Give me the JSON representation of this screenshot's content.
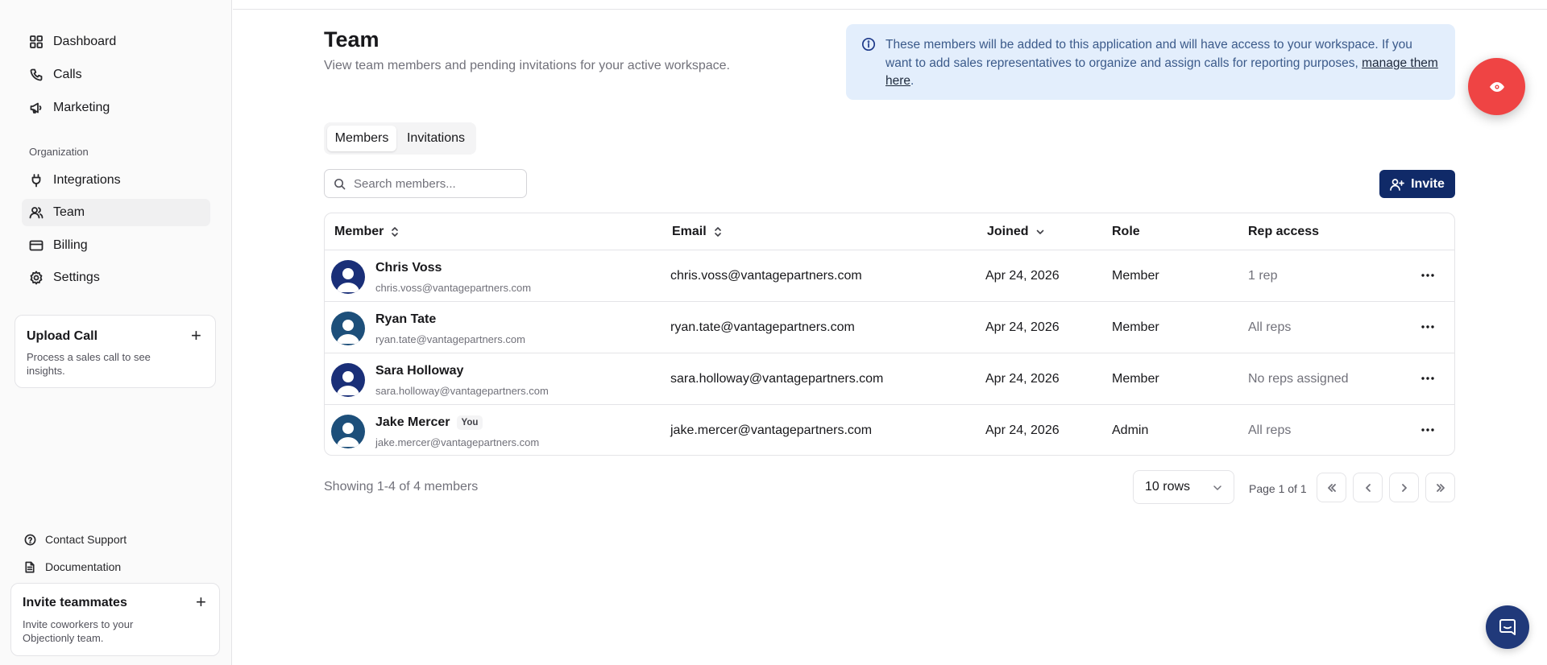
{
  "sidebar": {
    "nav": [
      {
        "label": "Dashboard",
        "icon": "dashboard-grid-icon"
      },
      {
        "label": "Calls",
        "icon": "phone-icon"
      },
      {
        "label": "Marketing",
        "icon": "megaphone-icon"
      }
    ],
    "section_label": "Organization",
    "org_nav": [
      {
        "label": "Integrations",
        "icon": "plug-icon"
      },
      {
        "label": "Team",
        "icon": "users-icon",
        "active": true
      },
      {
        "label": "Billing",
        "icon": "credit-card-icon"
      },
      {
        "label": "Settings",
        "icon": "gear-icon"
      }
    ],
    "upload_card": {
      "title": "Upload Call",
      "description": "Process a sales call to see insights.",
      "plus": "+"
    },
    "footer_links": [
      {
        "label": "Contact Support",
        "icon": "help-circle-icon"
      },
      {
        "label": "Documentation",
        "icon": "document-icon"
      }
    ],
    "invite_card": {
      "title": "Invite teammates",
      "description": "Invite coworkers to your Objectionly team.",
      "plus": "+"
    }
  },
  "header": {
    "title": "Team",
    "subtitle": "View team members and pending invitations for your active workspace."
  },
  "info_box": {
    "text": "These members will be added to this application and will have access to your workspace. If you want to add sales representatives to organize and assign calls for reporting purposes, ",
    "link": "manage them here",
    "end": "."
  },
  "tabs": [
    {
      "label": "Members",
      "active": true
    },
    {
      "label": "Invitations",
      "active": false
    }
  ],
  "search": {
    "placeholder": "Search members...",
    "value": ""
  },
  "invite_button": {
    "label": "Invite"
  },
  "table": {
    "columns": [
      "Member",
      "Email",
      "Joined",
      "Role",
      "Rep access"
    ],
    "rows": [
      {
        "name": "Chris Voss",
        "sub_email": "chris.voss@vantagepartners.com",
        "email": "chris.voss@vantagepartners.com",
        "joined": "Apr 24, 2026",
        "role": "Member",
        "rep_access": "1 rep",
        "badge": "",
        "avatar_color": "#1a2f78"
      },
      {
        "name": "Ryan Tate",
        "sub_email": "ryan.tate@vantagepartners.com",
        "email": "ryan.tate@vantagepartners.com",
        "joined": "Apr 24, 2026",
        "role": "Member",
        "rep_access": "All reps",
        "badge": "",
        "avatar_color": "#1d4f7a"
      },
      {
        "name": "Sara Holloway",
        "sub_email": "sara.holloway@vantagepartners.com",
        "email": "sara.holloway@vantagepartners.com",
        "joined": "Apr 24, 2026",
        "role": "Member",
        "rep_access": "No reps assigned",
        "badge": "",
        "avatar_color": "#1a2f78"
      },
      {
        "name": "Jake Mercer",
        "sub_email": "jake.mercer@vantagepartners.com",
        "email": "jake.mercer@vantagepartners.com",
        "joined": "Apr 24, 2026",
        "role": "Admin",
        "rep_access": "All reps",
        "badge": "You",
        "avatar_color": "#1d4f7a"
      }
    ]
  },
  "footer": {
    "showing": "Showing 1-4 of 4 members",
    "rows_select": "10 rows",
    "page_label": "Page 1 of 1"
  },
  "colors": {
    "primary": "#102a68",
    "fab": "#ef4444",
    "info_bg": "#e3eefc",
    "chat": "#20397a"
  }
}
